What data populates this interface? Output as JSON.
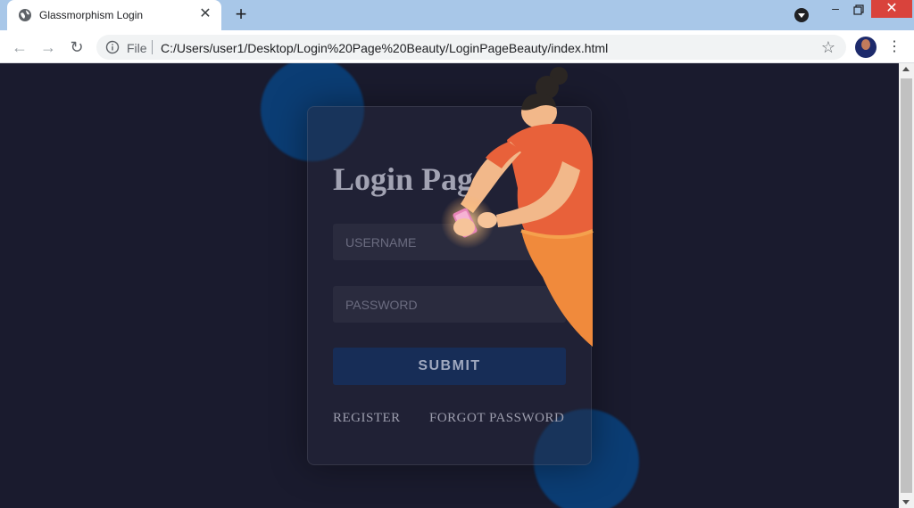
{
  "browser": {
    "tab_title": "Glassmorphism Login",
    "tab_icon": "globe-icon",
    "new_tab_symbol": "+",
    "close_symbol": "✕",
    "file_label": "File",
    "url": "C:/Users/user1/Desktop/Login%20Page%20Beauty/LoginPageBeauty/index.html",
    "back_symbol": "←",
    "forward_symbol": "→",
    "reload_symbol": "↻",
    "star_symbol": "☆",
    "menu_symbol": "⋮",
    "minimize_symbol": "–",
    "window_close_symbol": "✕"
  },
  "login": {
    "title": "Login Page",
    "username_placeholder": "USERNAME",
    "username_value": "",
    "password_placeholder": "PASSWORD",
    "password_value": "",
    "submit_label": "SUBMIT",
    "register_label": "REGISTER",
    "forgot_label": "FORGOT PASSWORD"
  },
  "colors": {
    "page_background": "#1a1b2e",
    "blob": "#0b3d74",
    "submit_background": "#172d57",
    "figure_shirt": "#e8613a",
    "figure_pants": "#f08a3c",
    "tabbar": "#a8c7e8",
    "window_close": "#d9433c"
  },
  "illustration": "person-holding-phone-illustration"
}
